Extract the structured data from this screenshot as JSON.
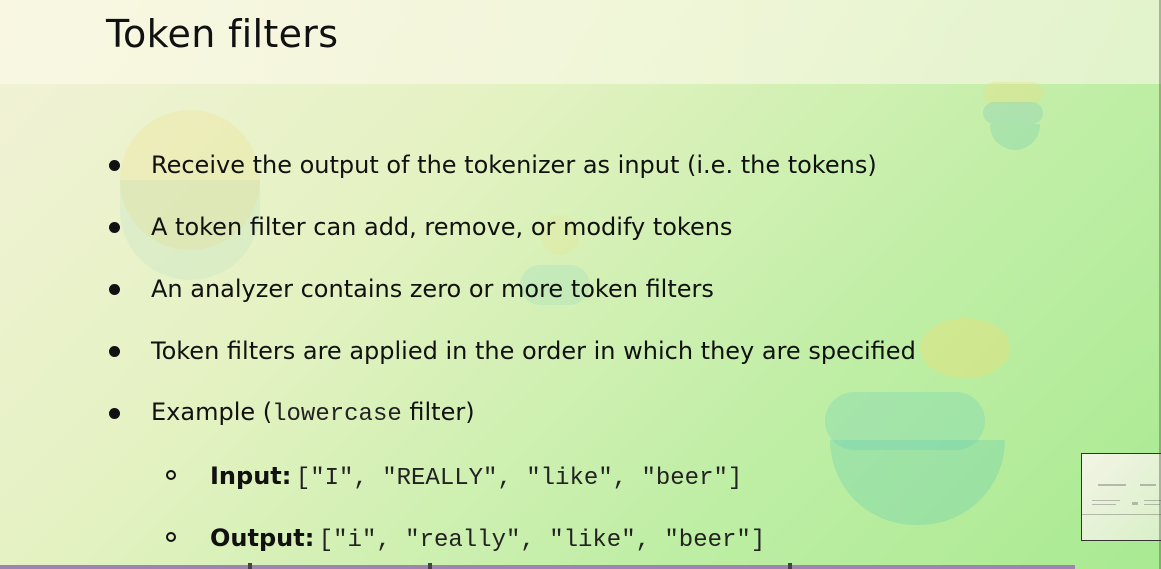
{
  "slide": {
    "title": "Token filters",
    "bullets": [
      {
        "text": "Receive the output of the tokenizer as input (i.e. the tokens)"
      },
      {
        "text": "A token filter can add, remove, or modify tokens"
      },
      {
        "text": "An analyzer contains zero or more token filters"
      },
      {
        "text": "Token filters are applied in the order in which they are specified"
      },
      {
        "prefix": "Example (",
        "code": "lowercase",
        "suffix": " filter)"
      }
    ],
    "sub_bullets": [
      {
        "label": "Input:",
        "value": "[\"I\", \"REALLY\", \"like\", \"beer\"]"
      },
      {
        "label": "Output:",
        "value": "[\"i\", \"really\", \"like\", \"beer\"]"
      }
    ]
  },
  "colors": {
    "background_start": "#f3f2d8",
    "background_end": "#a9ea92",
    "text": "#111111",
    "progress_bar": "#9f84b3"
  },
  "icons": {
    "bullet": "filled-circle",
    "sub_bullet": "hollow-circle",
    "background_decoration": "elastic-logo-watermark"
  }
}
